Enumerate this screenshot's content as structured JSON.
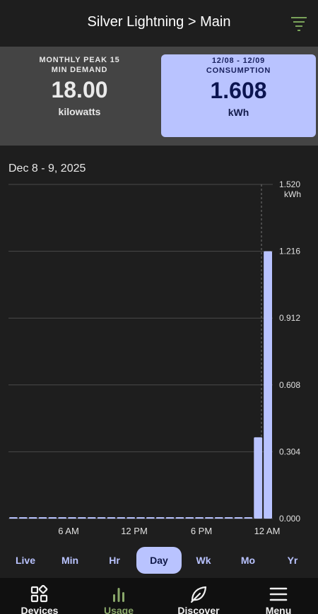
{
  "header": {
    "title": "Silver Lightning > Main"
  },
  "summary": {
    "peak": {
      "label_line1": "MONTHLY PEAK 15",
      "label_line2": "MIN DEMAND",
      "value": "18.00",
      "unit": "kilowatts"
    },
    "consumption": {
      "label_line1": "12/08 - 12/09",
      "label_line2": "CONSUMPTION",
      "value": "1.608",
      "unit": "kWh"
    }
  },
  "date_label": "Dec 8 - 9, 2025",
  "chart_data": {
    "type": "bar",
    "unit": "kWh",
    "yticks": [
      "1.520",
      "1.216",
      "0.912",
      "0.608",
      "0.304",
      "0.000"
    ],
    "ymax_label_unit": "kWh",
    "ylim": [
      0,
      1.52
    ],
    "xticks": [
      "6 AM",
      "12 PM",
      "6 PM",
      "12 AM"
    ],
    "values": [
      0.004,
      0.004,
      0.004,
      0.004,
      0.004,
      0.004,
      0.004,
      0.004,
      0.004,
      0.004,
      0.004,
      0.004,
      0.004,
      0.004,
      0.004,
      0.004,
      0.004,
      0.004,
      0.004,
      0.004,
      0.004,
      0.004,
      0.004,
      0.004,
      0.004,
      0.37,
      1.216
    ],
    "bar_color": "#b9c3ff",
    "grid": true
  },
  "ranges": [
    "Live",
    "Min",
    "Hr",
    "Day",
    "Wk",
    "Mo",
    "Yr"
  ],
  "active_range": "Day",
  "nav": [
    {
      "label": "Devices",
      "icon": "devices-icon"
    },
    {
      "label": "Usage",
      "icon": "usage-icon"
    },
    {
      "label": "Discover",
      "icon": "leaf-icon"
    },
    {
      "label": "Menu",
      "icon": "menu-icon"
    }
  ],
  "colors": {
    "accent": "#b9c3ff",
    "active_nav": "#8aa86a",
    "filter_icon": "#7aa35a"
  }
}
